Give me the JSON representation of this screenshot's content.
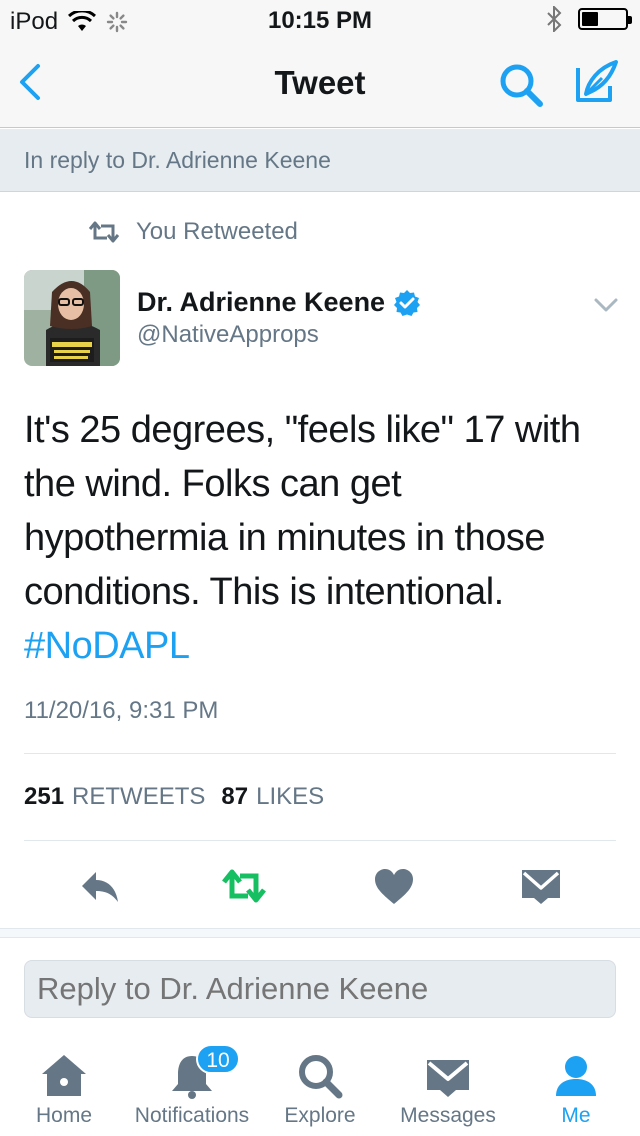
{
  "status_bar": {
    "carrier": "iPod",
    "time": "10:15 PM"
  },
  "nav": {
    "title": "Tweet"
  },
  "reply_banner": {
    "text": "In reply to Dr. Adrienne Keene"
  },
  "retweet_context": {
    "text": "You Retweeted"
  },
  "author": {
    "name": "Dr. Adrienne Keene",
    "handle": "@NativeApprops",
    "verified": true
  },
  "tweet": {
    "text_lines": [
      "It's 25 degrees, \"feels like\" 17 with",
      "the wind. Folks can get",
      "hypothermia in minutes in those",
      "conditions. This is intentional."
    ],
    "hashtag": "#NoDAPL",
    "timestamp": "11/20/16, 9:31 PM"
  },
  "stats": {
    "retweets_count": "251",
    "retweets_label": "RETWEETS",
    "likes_count": "87",
    "likes_label": "LIKES"
  },
  "reply_input": {
    "placeholder": "Reply to Dr. Adrienne Keene"
  },
  "tabs": [
    {
      "label": "Home",
      "icon": "home-icon"
    },
    {
      "label": "Notifications",
      "icon": "bell-icon",
      "badge": "10"
    },
    {
      "label": "Explore",
      "icon": "search-icon"
    },
    {
      "label": "Messages",
      "icon": "envelope-icon"
    },
    {
      "label": "Me",
      "icon": "person-icon"
    }
  ],
  "colors": {
    "accent": "#1da1f2",
    "retweet_active": "#17bf63",
    "secondary_text": "#657786",
    "icon_gray": "#657786"
  }
}
